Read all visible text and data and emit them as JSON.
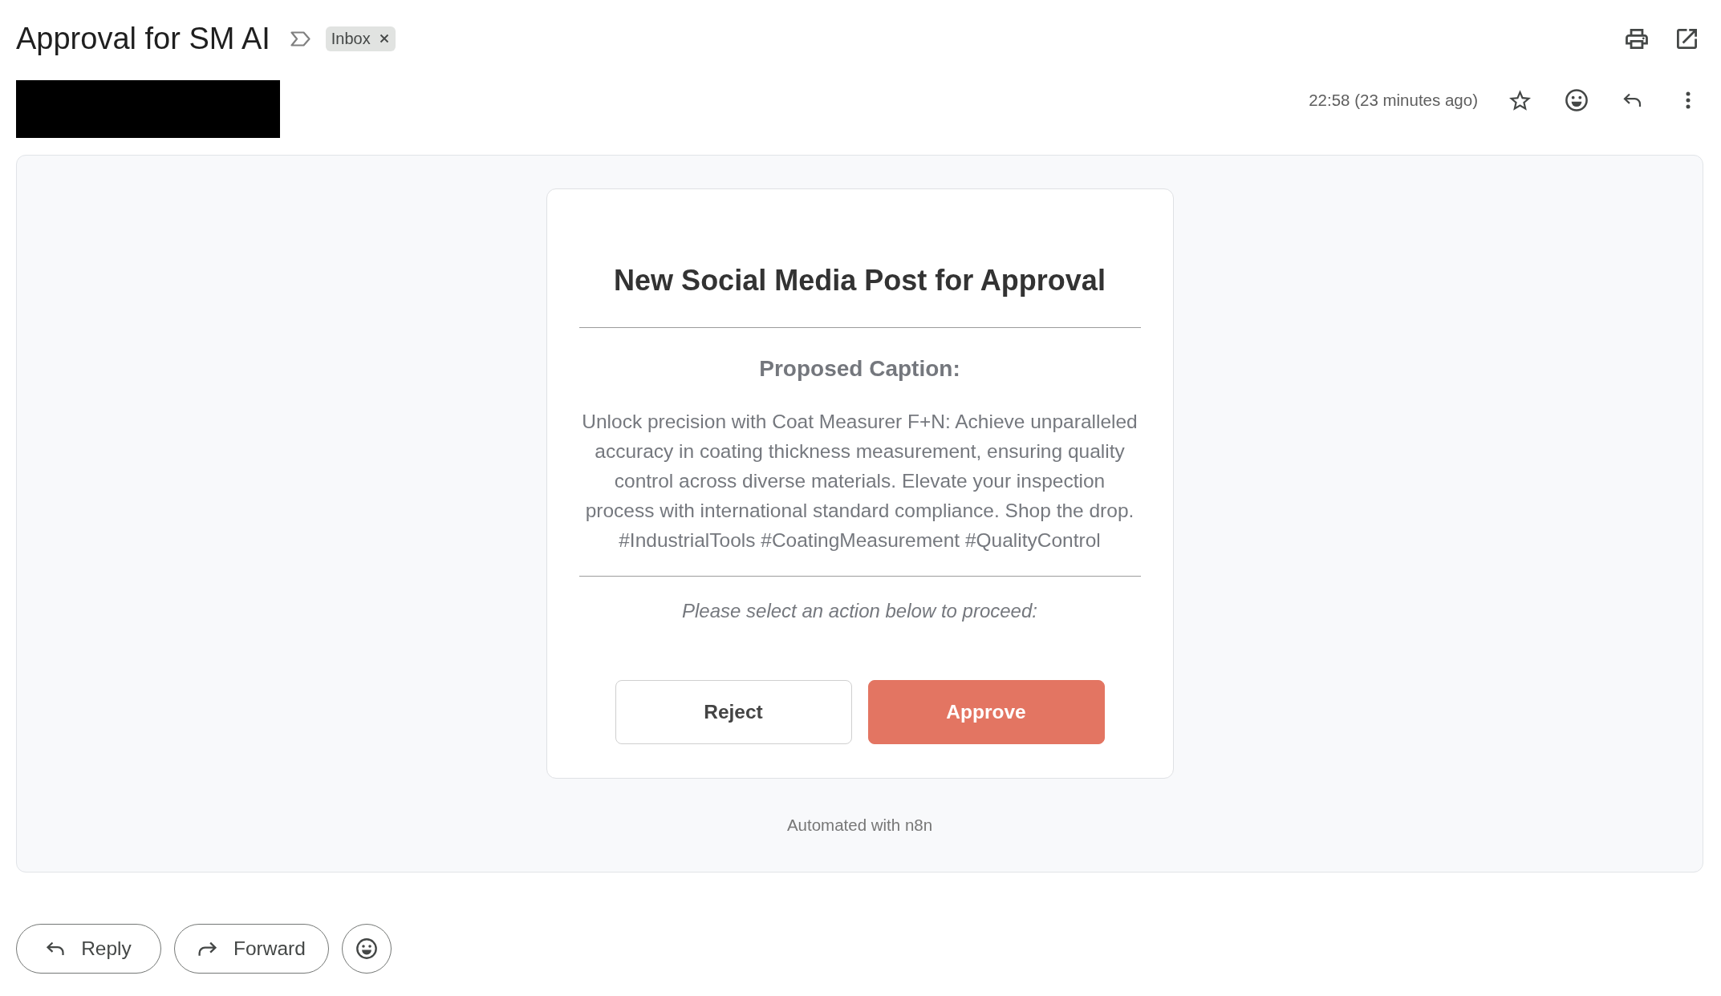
{
  "message": {
    "subject": "Approval for SM AI",
    "important": false,
    "labels": [
      {
        "name": "Inbox"
      }
    ],
    "timestamp": "22:58 (23 minutes ago)",
    "starred": false
  },
  "email_body": {
    "title": "New Social Media Post for Approval",
    "section_heading": "Proposed Caption:",
    "caption": "Unlock precision with Coat Measurer F+N: Achieve unparalleled accuracy in coating thickness measurement, ensuring quality control across diverse materials. Elevate your inspection process with international standard compliance. Shop the drop. #IndustrialTools #CoatingMeasurement #QualityControl",
    "prompt": "Please select an action below to proceed:",
    "actions": [
      {
        "label": "Reject",
        "kind": "reject"
      },
      {
        "label": "Approve",
        "kind": "approve"
      }
    ],
    "footer": "Automated with n8n"
  },
  "reply_actions": [
    {
      "label": "Reply",
      "kind": "reply"
    },
    {
      "label": "Forward",
      "kind": "forward"
    },
    {
      "kind": "react"
    }
  ]
}
